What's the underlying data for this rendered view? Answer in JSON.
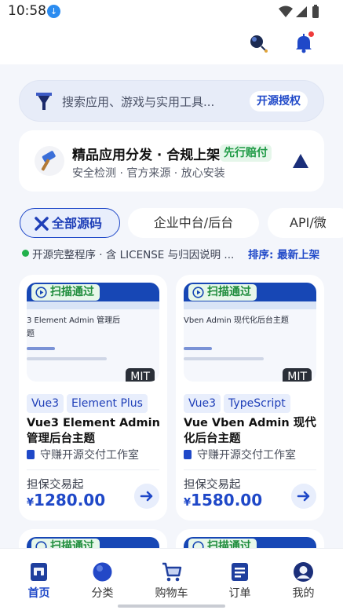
{
  "status_bar": {
    "time": "10:58"
  },
  "search": {
    "placeholder": "搜索应用、游戏与实用工具...",
    "button_label": "开源授权"
  },
  "promo": {
    "title": "精品应用分发 · 合规上架",
    "badge": "先行赔付",
    "subtitle": "安全检测 · 官方来源 · 放心安装"
  },
  "chips": [
    {
      "label": "全部源码",
      "selected": true
    },
    {
      "label": "企业中台/后台",
      "selected": false
    },
    {
      "label": "API/微",
      "selected": false
    }
  ],
  "info": {
    "text": "开源完整程序 · 含 LICENSE 与归因说明 ...",
    "sort_label": "排序: 最新上架"
  },
  "products": [
    {
      "scan_label": "扫描通过",
      "thumb_title": "3 Element Admin 管理后",
      "thumb_title_line2": "题",
      "license": "MIT",
      "tags": [
        "Vue3",
        "Element Plus"
      ],
      "title": "Vue3 Element Admin 管理后台主题",
      "vendor": "守赚开源交付工作室",
      "price_label": "担保交易起",
      "currency": "¥",
      "price": "1280.00"
    },
    {
      "scan_label": "扫描通过",
      "thumb_title": "Vben Admin 现代化后台主题",
      "thumb_title_line2": "",
      "license": "MIT",
      "tags": [
        "Vue3",
        "TypeScript"
      ],
      "title": "Vue Vben Admin 现代化后台主题",
      "vendor": "守赚开源交付工作室",
      "price_label": "担保交易起",
      "currency": "¥",
      "price": "1580.00"
    }
  ],
  "next_row": {
    "scan_label": "扫描通过"
  },
  "bottom_nav": [
    {
      "label": "首页",
      "icon": "home-icon",
      "active": true
    },
    {
      "label": "分类",
      "icon": "category-icon",
      "active": false
    },
    {
      "label": "购物车",
      "icon": "cart-icon",
      "active": false
    },
    {
      "label": "订单",
      "icon": "orders-icon",
      "active": false
    },
    {
      "label": "我的",
      "icon": "profile-icon",
      "active": false
    }
  ],
  "colors": {
    "brand": "#1f48c8",
    "success": "#22b14c",
    "background": "#f4f6fb",
    "notification": "#ef3b3b"
  }
}
